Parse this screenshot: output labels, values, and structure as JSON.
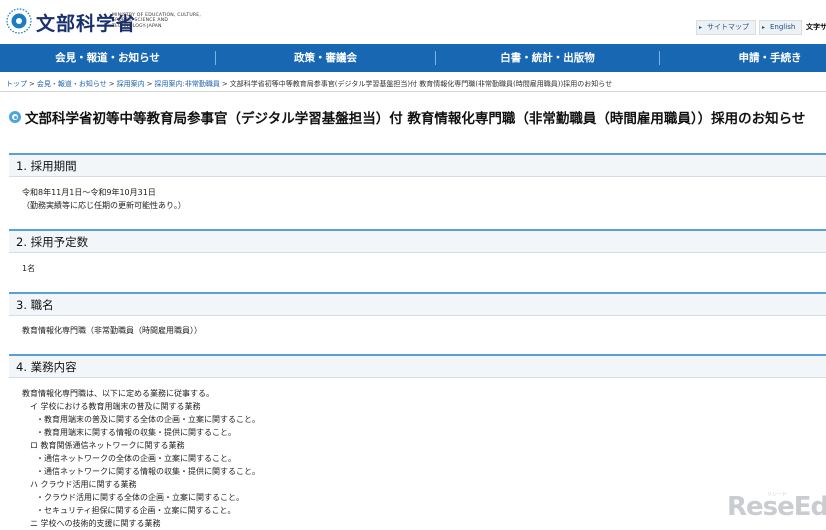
{
  "header": {
    "logo_jp": "文部科学省",
    "logo_en": "MINISTRY OF EDUCATION, CULTURE, SPORTS, SCIENCE AND TECHNOLOGY-JAPAN",
    "sitemap": "サイトマップ",
    "english": "English",
    "text_size": "文字サ"
  },
  "nav": {
    "items": [
      "会見・報道・お知らせ",
      "政策・審議会",
      "白書・統計・出版物",
      "申請・手続き"
    ]
  },
  "breadcrumb": {
    "items": [
      "トップ",
      "会見・報道・お知らせ",
      "採用案内",
      "採用案内:非常勤職員"
    ],
    "current": "文部科学省初等中等教育局参事官(デジタル学習基盤担当)付 教育情報化専門職(非常勤職員(時間雇用職員))採用のお知らせ",
    "separator": ">"
  },
  "page_title": "文部科学省初等中等教育局参事官（デジタル学習基盤担当）付 教育情報化専門職（非常勤職員（時間雇用職員））採用のお知らせ",
  "sections": [
    {
      "heading": "1. 採用期間",
      "body": "令和8年11月1日～令和9年10月31日\n（勤務実績等に応じ任期の更新可能性あり。）"
    },
    {
      "heading": "2. 採用予定数",
      "body": "1名"
    },
    {
      "heading": "3. 職名",
      "body": "教育情報化専門職（非常勤職員（時間雇用職員））"
    },
    {
      "heading": "4. 業務内容",
      "body": ""
    }
  ],
  "duties": {
    "intro": "教育情報化専門職は、以下に定める業務に従事する。",
    "lines": [
      {
        "level": 1,
        "text": "イ 学校における教育用端末の普及に関する業務"
      },
      {
        "level": 2,
        "text": "・教育用端末の普及に関する全体の企画・立案に関すること。"
      },
      {
        "level": 2,
        "text": "・教育用端末に関する情報の収集・提供に関すること。"
      },
      {
        "level": 1,
        "text": "ロ 教育関係通信ネットワークに関する業務"
      },
      {
        "level": 2,
        "text": "・通信ネットワークの全体の企画・立案に関すること。"
      },
      {
        "level": 2,
        "text": "・通信ネットワークに関する情報の収集・提供に関すること。"
      },
      {
        "level": 1,
        "text": "ハ クラウド活用に関する業務"
      },
      {
        "level": 2,
        "text": "・クラウド活用に関する全体の企画・立案に関すること。"
      },
      {
        "level": 2,
        "text": "・セキュリティ担保に関する企画・立案に関すること。"
      },
      {
        "level": 1,
        "text": "ニ 学校への技術的支援に関する業務"
      }
    ]
  },
  "watermark": {
    "text": "ReseEd",
    "sub": "リシード"
  },
  "colors": {
    "nav_bg": "#1867b3",
    "accent": "#5aa0d8",
    "logo": "#1a2f6e"
  }
}
